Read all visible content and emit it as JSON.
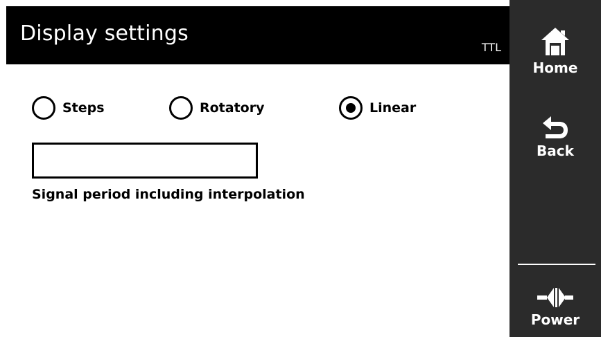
{
  "header": {
    "title": "Display settings",
    "signal_type": "TTL"
  },
  "display_mode": {
    "options": [
      {
        "label": "Steps",
        "selected": false
      },
      {
        "label": "Rotatory",
        "selected": false
      },
      {
        "label": "Linear",
        "selected": true
      }
    ]
  },
  "signal_period": {
    "value": "",
    "caption": "Signal period including interpolation"
  },
  "sidebar": {
    "home_label": "Home",
    "back_label": "Back",
    "power_label": "Power"
  },
  "colors": {
    "header_bg": "#000000",
    "sidebar_bg": "#2b2b2b",
    "text": "#000000",
    "sidebar_text": "#ffffff"
  },
  "icons": [
    "house-icon",
    "back-arrow-icon",
    "power-plug-icon"
  ]
}
